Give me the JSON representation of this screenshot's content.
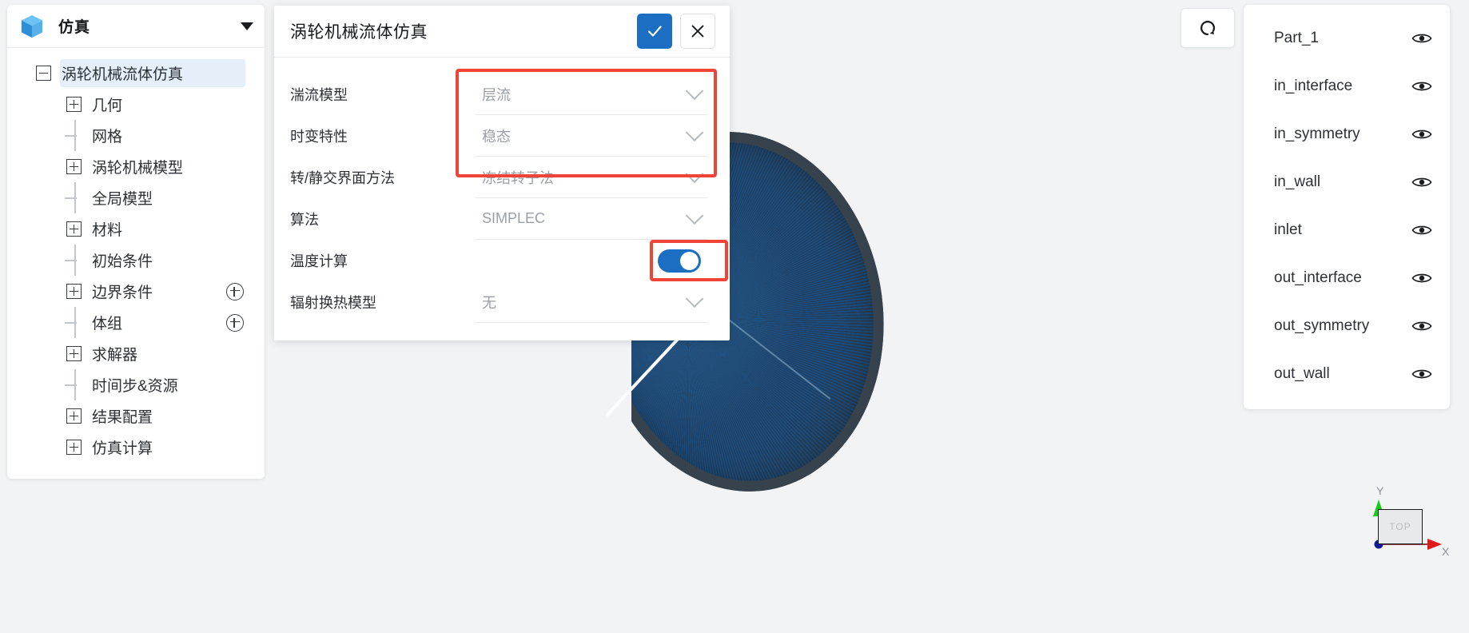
{
  "sidebar": {
    "app_icon": "cube-icon",
    "app_title": "仿真",
    "dropdown_icon": "caret-down-icon",
    "tree": [
      {
        "label": "涡轮机械流体仿真",
        "type": "expander-minus",
        "level": 0,
        "selected": true,
        "add_button": false
      },
      {
        "label": "几何",
        "type": "expander-plus",
        "level": 1,
        "selected": false,
        "add_button": false
      },
      {
        "label": "网格",
        "type": "leaf",
        "level": 1,
        "selected": false,
        "add_button": false
      },
      {
        "label": "涡轮机械模型",
        "type": "expander-plus",
        "level": 1,
        "selected": false,
        "add_button": false
      },
      {
        "label": "全局模型",
        "type": "leaf",
        "level": 1,
        "selected": false,
        "add_button": false
      },
      {
        "label": "材料",
        "type": "expander-plus",
        "level": 1,
        "selected": false,
        "add_button": false
      },
      {
        "label": "初始条件",
        "type": "leaf",
        "level": 1,
        "selected": false,
        "add_button": false
      },
      {
        "label": "边界条件",
        "type": "expander-plus",
        "level": 1,
        "selected": false,
        "add_button": true
      },
      {
        "label": "体组",
        "type": "leaf",
        "level": 1,
        "selected": false,
        "add_button": true
      },
      {
        "label": "求解器",
        "type": "expander-plus",
        "level": 1,
        "selected": false,
        "add_button": false
      },
      {
        "label": "时间步&资源",
        "type": "leaf",
        "level": 1,
        "selected": false,
        "add_button": false
      },
      {
        "label": "结果配置",
        "type": "expander-plus",
        "level": 1,
        "selected": false,
        "add_button": false
      },
      {
        "label": "仿真计算",
        "type": "expander-plus",
        "level": 1,
        "selected": false,
        "add_button": false
      }
    ]
  },
  "dialog": {
    "title": "涡轮机械流体仿真",
    "confirm_icon": "check-icon",
    "cancel_icon": "close-icon",
    "fields": [
      {
        "label": "湍流模型",
        "value": "层流",
        "control": "select",
        "highlighted": true
      },
      {
        "label": "时变特性",
        "value": "稳态",
        "control": "select",
        "highlighted": true
      },
      {
        "label": "转/静交界面方法",
        "value": "冻结转子法",
        "control": "select",
        "highlighted": true
      },
      {
        "label": "算法",
        "value": "SIMPLEC",
        "control": "select",
        "highlighted": false
      },
      {
        "label": "温度计算",
        "value": "on",
        "control": "toggle",
        "highlighted": true
      },
      {
        "label": "辐射换热模型",
        "value": "无",
        "control": "select",
        "highlighted": false
      }
    ],
    "annotation_color": "#f04438"
  },
  "toolbar": {
    "reset_view_icon": "reset-rotate-icon"
  },
  "parts_panel": {
    "items": [
      {
        "name": "Part_1",
        "visibility_icon": "eye-icon"
      },
      {
        "name": "in_interface",
        "visibility_icon": "eye-icon"
      },
      {
        "name": "in_symmetry",
        "visibility_icon": "eye-icon"
      },
      {
        "name": "in_wall",
        "visibility_icon": "eye-icon"
      },
      {
        "name": "inlet",
        "visibility_icon": "eye-icon"
      },
      {
        "name": "out_interface",
        "visibility_icon": "eye-icon"
      },
      {
        "name": "out_symmetry",
        "visibility_icon": "eye-icon"
      },
      {
        "name": "out_wall",
        "visibility_icon": "eye-icon"
      }
    ]
  },
  "viewport": {
    "triad": {
      "face_label": "TOP",
      "y_label": "Y",
      "x_label": "X",
      "x_axis_color": "#cc0000",
      "y_axis_color": "#00b400",
      "origin_color": "#1f2fa0"
    },
    "mesh_color": "#1d5a94",
    "mesh_rim_color": "#3a434c",
    "background_color": "#f2f3f5"
  }
}
